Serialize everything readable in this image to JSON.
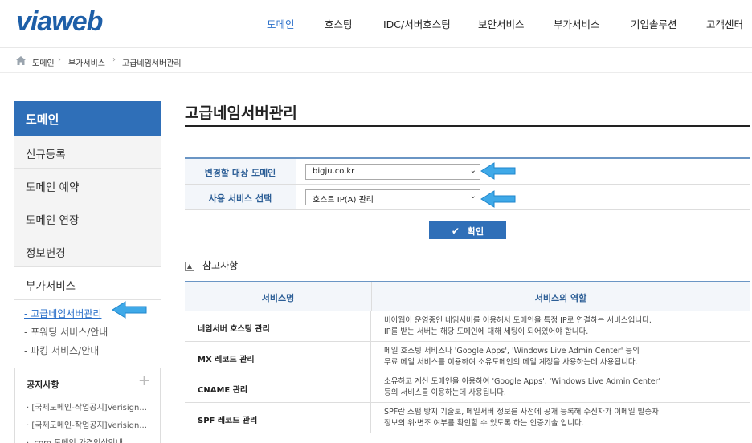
{
  "header": {
    "logo": "viaweb",
    "nav": [
      "도메인",
      "호스팅",
      "IDC/서버호스팅",
      "보안서비스",
      "부가서비스",
      "기업솔루션",
      "고객센터"
    ],
    "active_nav": 0,
    "accent_color": "#2a6fc9"
  },
  "breadcrumb": {
    "home_icon": "home-icon",
    "items": [
      "도메인",
      "부가서비스",
      "고급네임서버관리"
    ]
  },
  "sidebar": {
    "title": "도메인",
    "items": [
      "신규등록",
      "도메인 예약",
      "도메인 연장",
      "정보변경",
      "부가서비스"
    ],
    "sub_items": [
      {
        "label": "- 고급네임서버관리",
        "active": true
      },
      {
        "label": "- 포워딩 서비스/안내",
        "active": false
      },
      {
        "label": "- 파킹 서비스/안내",
        "active": false
      }
    ],
    "notice": {
      "title": "공지사항",
      "more_icon": "plus-icon",
      "items": [
        "· [국제도메인-작업공지]Verisign...",
        "· [국제도메인-작업공지]Verisign...",
        "· .com 도메인 가격인상안내"
      ]
    }
  },
  "main": {
    "title": "고급네임서버관리",
    "form": {
      "domain_label": "변경할 대상 도메인",
      "domain_value": "bigju.co.kr",
      "service_label": "사용 서비스 선택",
      "service_value": "호스트 IP(A) 관리"
    },
    "confirm_button": "확인",
    "reference_title": "참고사항",
    "table": {
      "headers": [
        "서비스명",
        "서비스의 역할"
      ],
      "rows": [
        {
          "name": "네임서버 호스팅 관리",
          "desc": [
            "비아웹이 운영중인 네임서버를 이용해서 도메인을 특정 IP로 연결하는 서비스입니다.",
            "IP를 받는 서버는 해당 도메인에 대해 세팅이 되어있어야 합니다."
          ]
        },
        {
          "name": "MX 레코드 관리",
          "desc": [
            "메일 호스팅 서비스나 'Google Apps', 'Windows Live Admin Center' 등의",
            "무료 메일 서비스를 이용하여 소유도메인의 메일 계정을 사용하는데 사용됩니다."
          ]
        },
        {
          "name": "CNAME 관리",
          "desc": [
            "소유하고 계신 도메인을 이용하여 'Google Apps', 'Windows Live Admin Center'",
            "등의 서비스를 이용하는데 사용됩니다."
          ]
        },
        {
          "name": "SPF 레코드 관리",
          "desc": [
            "SPF란 스팸 방지 기술로, 메일서버 정보를 사전에 공개 등록해 수신자가 이메일 발송자",
            "정보의 위·변조 여부를 확인할 수 있도록 하는 인증기술 입니다."
          ]
        }
      ]
    }
  }
}
